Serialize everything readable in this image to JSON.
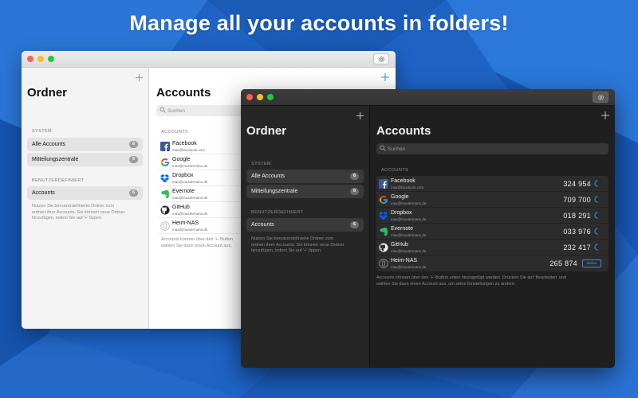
{
  "headline": "Manage all your accounts in folders!",
  "light": {
    "sidebar": {
      "title": "Ordner",
      "section_system": "SYSTEM",
      "items": [
        {
          "label": "Alle Accounts",
          "count": "6"
        },
        {
          "label": "Mitteilungszentrale",
          "count": "6"
        }
      ],
      "section_custom": "BENUTZERDEFINIERT",
      "custom_items": [
        {
          "label": "Accounts",
          "count": "6"
        }
      ],
      "help_line1": "Nutzen Sie benutzerdefinierte Ordner zum",
      "help_line2": "ordnen ihrer Accounts. Sie können neue Ordner",
      "help_line3": "hinzufügen, indem Sie auf '+' tippen."
    },
    "main": {
      "title": "Accounts",
      "search_placeholder": "Suchen",
      "section": "ACCOUNTS",
      "accounts": [
        {
          "name": "Facebook",
          "email": "max@facebook.com"
        },
        {
          "name": "Google",
          "email": "max@mustermann.de"
        },
        {
          "name": "Dropbox",
          "email": "max@mustermann.de"
        },
        {
          "name": "Evernote",
          "email": "max@mustermann.de"
        },
        {
          "name": "GitHub",
          "email": "max@mustermann.de"
        },
        {
          "name": "Heim-NAS",
          "email": "max@mustermann.de"
        }
      ],
      "footer_line1": "Accounts können über den '+'-Button",
      "footer_line2": "wählen Sie dann einen Account aus,"
    }
  },
  "dark": {
    "sidebar": {
      "title": "Ordner",
      "section_system": "SYSTEM",
      "items": [
        {
          "label": "Alle Accounts",
          "count": "6"
        },
        {
          "label": "Mitteilungszentrale",
          "count": "6"
        }
      ],
      "section_custom": "BENUTZERDEFINIERT",
      "custom_items": [
        {
          "label": "Accounts",
          "count": "6"
        }
      ],
      "help_line1": "Nutzen Sie benutzerdefinierte Ordner zum",
      "help_line2": "ordnen ihrer Accounts. Sie können neue Ordner",
      "help_line3": "hinzufügen, indem Sie auf '+' tippen."
    },
    "main": {
      "title": "Accounts",
      "search_placeholder": "Suchen",
      "section": "ACCOUNTS",
      "accounts": [
        {
          "name": "Facebook",
          "email": "max@facebook.com",
          "code": "324 954"
        },
        {
          "name": "Google",
          "email": "max@mustermann.de",
          "code": "709 700"
        },
        {
          "name": "Dropbox",
          "email": "max@mustermann.de",
          "code": "018 291"
        },
        {
          "name": "Evernote",
          "email": "max@mustermann.de",
          "code": "033 976"
        },
        {
          "name": "GitHub",
          "email": "max@mustermann.de",
          "code": "232 417"
        },
        {
          "name": "Heim-NAS",
          "email": "max@mustermann.de",
          "code": "265 874",
          "button": "Weiter"
        }
      ],
      "footer_line1": "Accounts können über den '+'-Button unten hinzugefügt werden. Drücken Sie auf 'Bearbeiten' und",
      "footer_line2": "wählen Sie dann einen Account aus, um seine Einstellungen zu ändern."
    }
  },
  "colors": {
    "background": "#1e63c4",
    "accent": "#2d8cf0",
    "facebook": "#3b5998",
    "dropbox": "#0061fe",
    "evernote": "#2dbe60"
  },
  "icons": [
    "gear-icon",
    "plus-icon",
    "search-icon",
    "facebook-icon",
    "google-icon",
    "dropbox-icon",
    "evernote-icon",
    "github-icon",
    "nas-icon"
  ]
}
